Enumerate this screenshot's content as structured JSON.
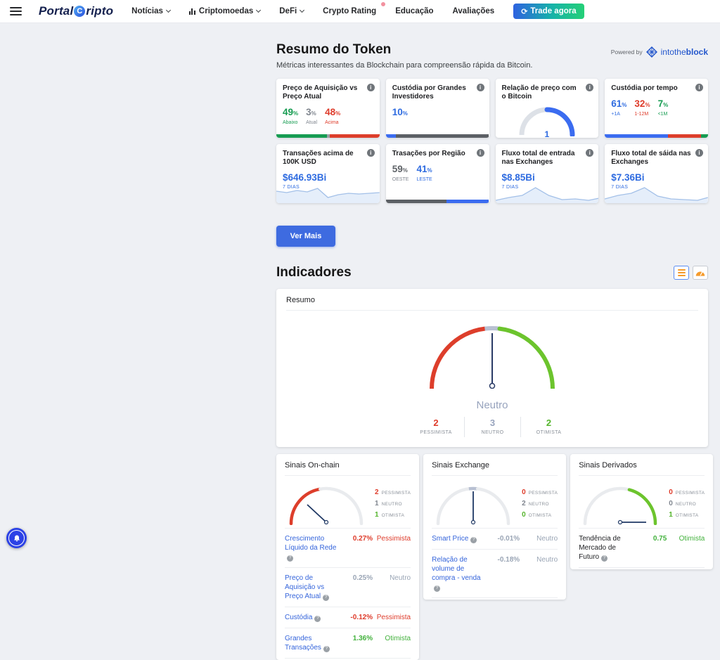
{
  "icons": {
    "info": "i",
    "question": "?"
  },
  "colors": {
    "accent_blue": "#2e6be0",
    "red": "#de3b2a",
    "teal_green": "#179c52",
    "lime_green": "#54b42c",
    "dark_gray": "#5c6065",
    "orange": "#f59b2c",
    "ver_mais_blue": "#3e6be0"
  },
  "navbar": {
    "logo": {
      "part1": "Portal",
      "symbol": "C",
      "part2": "ripto"
    },
    "items": [
      "Notícias",
      "Criptomoedas",
      "DeFi",
      "Crypto Rating",
      "Educação",
      "Avaliações"
    ],
    "trade_button": {
      "icon": "⟳",
      "label": "Trade agora"
    }
  },
  "token_summary": {
    "title": "Resumo do Token",
    "subtitle": "Métricas interessantes da Blockchain para compreensão rápida da Bitcoin.",
    "powered_by": "Powered by",
    "provider": {
      "part1": "intothe",
      "part2": "block"
    },
    "ver_mais": "Ver Mais",
    "cards": [
      {
        "title": "Preço de Aquisição vs Preço Atual",
        "stats": [
          {
            "value": "49",
            "unit": "%",
            "label": "Abaixo"
          },
          {
            "value": "3",
            "unit": "%",
            "label": "Atual"
          },
          {
            "value": "48",
            "unit": "%",
            "label": "Acima"
          }
        ],
        "bar": [
          {
            "width": "49%"
          },
          {
            "width": "3%"
          },
          {
            "width": "48%"
          }
        ]
      },
      {
        "title": "Custódia por Grandes Investidores",
        "stats": [
          {
            "value": "10",
            "unit": "%"
          }
        ],
        "bar": [
          {
            "width": "10%"
          },
          {
            "width": "90%"
          }
        ]
      },
      {
        "title": "Relação de preço com o Bitcoin",
        "gauge_value": "1"
      },
      {
        "title": "Custódia por tempo",
        "stats": [
          {
            "value": "61",
            "unit": "%",
            "label": "+1A"
          },
          {
            "value": "32",
            "unit": "%",
            "label": "1-12M"
          },
          {
            "value": "7",
            "unit": "%",
            "label": "<1M"
          }
        ],
        "bar": [
          {
            "width": "61%"
          },
          {
            "width": "32%"
          },
          {
            "width": "7%"
          }
        ]
      },
      {
        "title": "Transações acima de 100K USD",
        "value": "$646.93Bi",
        "period": "7 DIAS"
      },
      {
        "title": "Trasações por Região",
        "stats": [
          {
            "value": "59",
            "unit": "%",
            "label": "OESTE"
          },
          {
            "value": "41",
            "unit": "%",
            "label": "LESTE"
          }
        ],
        "bar": [
          {
            "width": "59%"
          },
          {
            "width": "41%"
          }
        ]
      },
      {
        "title": "Fluxo total de entrada nas Exchanges",
        "value": "$8.85Bi",
        "period": "7 DIAS"
      },
      {
        "title": "Fluxo total de sáida nas Exchanges",
        "value": "$7.36Bi",
        "period": "7 DIAS"
      }
    ]
  },
  "indicators": {
    "title": "Indicadores",
    "summary": {
      "panel_title": "Resumo",
      "status": "Neutro",
      "stats": [
        {
          "value": "2",
          "label": "PESSIMISTA"
        },
        {
          "value": "3",
          "label": "NEUTRO"
        },
        {
          "value": "2",
          "label": "OTIMISTA"
        }
      ]
    },
    "panels": [
      {
        "title": "Sinais On-chain",
        "legend": [
          {
            "value": "2",
            "label": "PESSIMISTA"
          },
          {
            "value": "1",
            "label": "NEUTRO"
          },
          {
            "value": "1",
            "label": "OTIMISTA"
          }
        ],
        "rows": [
          {
            "label": "Crescimento Líquido da Rede",
            "value": "0.27%",
            "status": "Pessimista"
          },
          {
            "label": "Preço de Aquisição vs Preço Atual",
            "value": "0.25%",
            "status": "Neutro"
          },
          {
            "label": "Custódia",
            "value": "-0.12%",
            "status": "Pessimista"
          },
          {
            "label": "Grandes Transações",
            "value": "1.36%",
            "status": "Otimista"
          }
        ]
      },
      {
        "title": "Sinais Exchange",
        "legend": [
          {
            "value": "0",
            "label": "PESSIMISTA"
          },
          {
            "value": "2",
            "label": "NEUTRO"
          },
          {
            "value": "0",
            "label": "OTIMISTA"
          }
        ],
        "rows": [
          {
            "label": "Smart Price",
            "value": "-0.01%",
            "status": "Neutro"
          },
          {
            "label": "Relação de volume de compra - venda",
            "value": "-0.18%",
            "status": "Neutro"
          }
        ]
      },
      {
        "title": "Sinais Derivados",
        "legend": [
          {
            "value": "0",
            "label": "PESSIMISTA"
          },
          {
            "value": "0",
            "label": "NEUTRO"
          },
          {
            "value": "1",
            "label": "OTIMISTA"
          }
        ],
        "rows": [
          {
            "label": "Tendência de Mercado de Futuro",
            "value": "0.75",
            "status": "Otimista"
          }
        ]
      }
    ]
  }
}
